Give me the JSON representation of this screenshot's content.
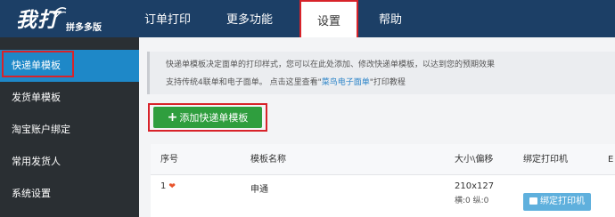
{
  "logo": {
    "main": "我打",
    "sub": "拼多多版"
  },
  "nav": {
    "orders": "订单打印",
    "more": "更多功能",
    "settings": "设置",
    "help": "帮助"
  },
  "sidebar": {
    "items": [
      {
        "label": "快递单模板",
        "active": true
      },
      {
        "label": "发货单模板",
        "active": false
      },
      {
        "label": "淘宝账户绑定",
        "active": false
      },
      {
        "label": "常用发货人",
        "active": false
      },
      {
        "label": "系统设置",
        "active": false
      }
    ]
  },
  "notice": {
    "line1": "快递单模板决定面单的打印样式，您可以在此处添加、修改快递单模板，以达到您的预期效果",
    "line2_prefix": "支持传统4联单和电子面单。 点击这里查看\"",
    "line2_link": "菜鸟电子面单",
    "line2_suffix": "\"打印教程"
  },
  "add_button": {
    "label": "添加快递单模板"
  },
  "table": {
    "headers": [
      "序号",
      "模板名称",
      "大小\\偏移",
      "绑定打印机",
      "E"
    ],
    "rows": [
      {
        "index": "1",
        "name": "申通",
        "size": "210x127",
        "offset": "横:0 纵:0",
        "bind_label": "绑定打印机"
      }
    ]
  },
  "colors": {
    "topbar": "#1c3f66",
    "sidebar": "#2a2f33",
    "active": "#1e88c8",
    "add_button": "#2f9e3e",
    "highlight": "#d8232a"
  }
}
